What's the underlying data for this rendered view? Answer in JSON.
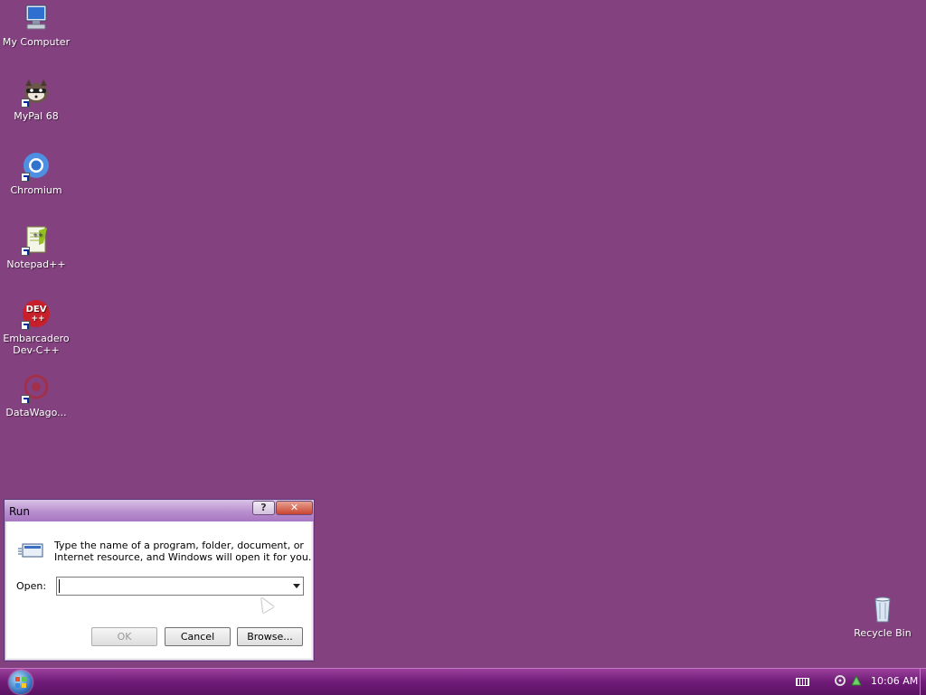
{
  "desktop": {
    "icons": [
      {
        "label": "My Computer",
        "icon": "computer-icon"
      },
      {
        "label": "MyPal 68",
        "icon": "mypal-icon"
      },
      {
        "label": "Chromium",
        "icon": "chromium-icon"
      },
      {
        "label": "Notepad++",
        "icon": "notepad-plus-plus-icon"
      },
      {
        "label_line1": "Embarcadero",
        "label_line2": "Dev-C++",
        "icon": "dev-cpp-icon",
        "icon_text": "DEV",
        "icon_text2": "++"
      },
      {
        "label": "DataWago...",
        "icon": "datawagon-icon"
      },
      {
        "label": "Recycle Bin",
        "icon": "recycle-bin-icon"
      }
    ],
    "background_color": "#84417f"
  },
  "run_dialog": {
    "title": "Run",
    "help_glyph": "?",
    "close_glyph": "✕",
    "description_line1": "Type the name of a program, folder, document, or",
    "description_line2": "Internet resource, and Windows will open it for you.",
    "open_label": "Open:",
    "open_value": "",
    "ok_label": "OK",
    "cancel_label": "Cancel",
    "browse_label": "Browse..."
  },
  "taskbar": {
    "clock": "10:06 AM",
    "tray_icons": [
      "keyboard-icon",
      "network-icon",
      "safely-remove-icon"
    ]
  }
}
